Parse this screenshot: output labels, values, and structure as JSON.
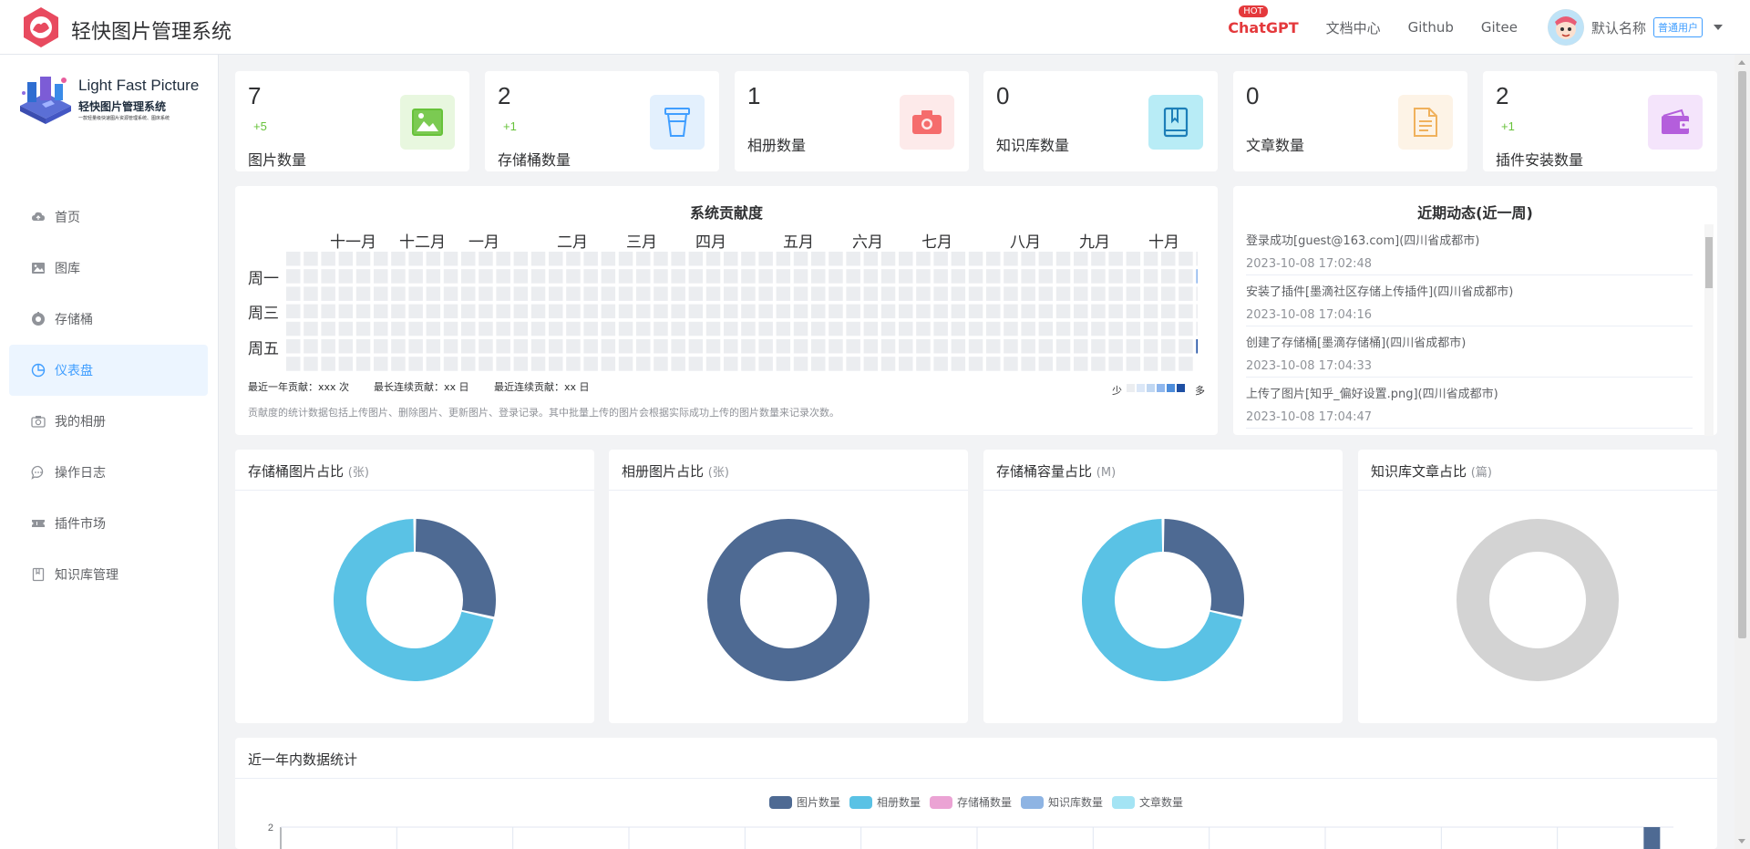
{
  "header": {
    "app_title": "轻快图片管理系统",
    "nav": [
      {
        "label": "ChatGPT",
        "badge": "HOT",
        "highlight": true
      },
      {
        "label": "文档中心"
      },
      {
        "label": "Github"
      },
      {
        "label": "Gitee"
      }
    ],
    "user": {
      "name": "默认名称",
      "role_tag": "普通用户"
    }
  },
  "sidebar": {
    "logo": {
      "title_en": "Light Fast Picture",
      "title_cn": "轻快图片管理系统",
      "subtitle": "一款轻量级快速图片资源管理系统、图床系统"
    },
    "items": [
      {
        "label": "首页",
        "icon": "cloud-icon",
        "active": false
      },
      {
        "label": "图库",
        "icon": "picture-icon",
        "active": false
      },
      {
        "label": "存储桶",
        "icon": "bucket-icon",
        "active": false
      },
      {
        "label": "仪表盘",
        "icon": "pie-chart-icon",
        "active": true
      },
      {
        "label": "我的相册",
        "icon": "camera-icon",
        "active": false
      },
      {
        "label": "操作日志",
        "icon": "chat-icon",
        "active": false
      },
      {
        "label": "插件市场",
        "icon": "ticket-icon",
        "active": false
      },
      {
        "label": "知识库管理",
        "icon": "notebook-icon",
        "active": false
      }
    ]
  },
  "stats": [
    {
      "value": "7",
      "increment": "+5",
      "label": "图片数量",
      "icon": "picture-icon",
      "color": "#67c23a",
      "bg": "#e8f7df"
    },
    {
      "value": "2",
      "increment": "+1",
      "label": "存储桶数量",
      "icon": "bucket-icon",
      "color": "#409eff",
      "bg": "#e3f0fd"
    },
    {
      "value": "1",
      "increment": "",
      "label": "相册数量",
      "icon": "camera-icon",
      "color": "#f56c6c",
      "bg": "#fdeaea"
    },
    {
      "value": "0",
      "increment": "",
      "label": "知识库数量",
      "icon": "book-icon",
      "color": "#1d7fb8",
      "bg": "#b8ecf6"
    },
    {
      "value": "0",
      "increment": "",
      "label": "文章数量",
      "icon": "document-icon",
      "color": "#f0b15c",
      "bg": "#fdf3e6"
    },
    {
      "value": "2",
      "increment": "+1",
      "label": "插件安装数量",
      "icon": "wallet-icon",
      "color": "#b45edc",
      "bg": "#f4e4fb"
    }
  ],
  "contribution": {
    "title": "系统贡献度",
    "months": [
      "十一月",
      "十二月",
      "一月",
      "二月",
      "三月",
      "四月",
      "五月",
      "六月",
      "七月",
      "八月",
      "九月",
      "十月"
    ],
    "days": [
      "周一",
      "周三",
      "周五"
    ],
    "meta": {
      "year": "最近一年贡献：xxx 次",
      "longest": "最长连续贡献：xx 日",
      "recent": "最近连续贡献：xx 日"
    },
    "note": "贡献度的统计数据包括上传图片、删除图片、更新图片、登录记录。其中批量上传的图片会根据实际成功上传的图片数量来记录次数。",
    "legend_less": "少",
    "legend_more": "多",
    "scale_colors": [
      "#ebedf0",
      "#dbe7f7",
      "#c0d7f2",
      "#8fb7ee",
      "#4d8ddb",
      "#1e4fa3"
    ],
    "active_cells": [
      {
        "week": 52,
        "day": 1,
        "level": 3
      },
      {
        "week": 52,
        "day": 5,
        "level": 5
      }
    ]
  },
  "activity": {
    "title": "近期动态(近一周)",
    "items": [
      {
        "text": "登录成功[guest@163.com](四川省成都市)",
        "time": "2023-10-08 17:02:48"
      },
      {
        "text": "安装了插件[墨滴社区存储上传插件](四川省成都市)",
        "time": "2023-10-08 17:04:16"
      },
      {
        "text": "创建了存储桶[墨滴存储桶](四川省成都市)",
        "time": "2023-10-08 17:04:33"
      },
      {
        "text": "上传了图片[知乎_偏好设置.png](四川省成都市)",
        "time": "2023-10-08 17:04:47"
      }
    ]
  },
  "donuts": [
    {
      "title": "存储桶图片占比",
      "unit": "(张)",
      "slices": [
        {
          "value": 2,
          "color": "#4e6a93"
        },
        {
          "value": 5,
          "color": "#5ac2e5"
        }
      ]
    },
    {
      "title": "相册图片占比",
      "unit": "(张)",
      "slices": [
        {
          "value": 1,
          "color": "#4e6a93"
        }
      ]
    },
    {
      "title": "存储桶容量占比",
      "unit": "(M)",
      "slices": [
        {
          "value": 2,
          "color": "#4e6a93"
        },
        {
          "value": 5,
          "color": "#5ac2e5"
        }
      ]
    },
    {
      "title": "知识库文章占比",
      "unit": "(篇)",
      "slices": [],
      "empty_color": "#d3d3d3"
    }
  ],
  "yearly": {
    "title": "近一年内数据统计",
    "legend": [
      {
        "label": "图片数量",
        "color": "#4e6a93"
      },
      {
        "label": "相册数量",
        "color": "#5ac2e5"
      },
      {
        "label": "存储桶数量",
        "color": "#eba3d4"
      },
      {
        "label": "知识库数量",
        "color": "#8eb4e3"
      },
      {
        "label": "文章数量",
        "color": "#a4e4f4"
      }
    ],
    "y_top_tick": "2",
    "chart_data": {
      "type": "bar",
      "series": [
        {
          "name": "图片数量",
          "values": [
            0,
            0,
            0,
            0,
            0,
            0,
            0,
            0,
            0,
            0,
            0,
            2
          ]
        }
      ],
      "ylim": [
        0,
        2
      ]
    }
  }
}
